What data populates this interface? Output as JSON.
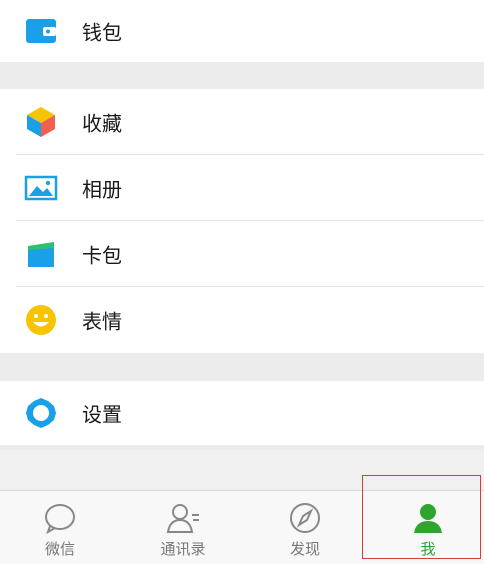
{
  "menu": {
    "wallet_label": "钱包",
    "favorites_label": "收藏",
    "album_label": "相册",
    "cards_label": "卡包",
    "stickers_label": "表情",
    "settings_label": "设置"
  },
  "tabbar": {
    "tabs": [
      {
        "label": "微信",
        "icon": "chat-bubble-icon"
      },
      {
        "label": "通讯录",
        "icon": "contacts-icon"
      },
      {
        "label": "发现",
        "icon": "compass-icon"
      },
      {
        "label": "我",
        "icon": "person-icon",
        "active": true
      }
    ]
  },
  "colors": {
    "active_green": "#2fa42f",
    "icon_blue": "#1aa0e8",
    "sticker_yellow": "#f6c400",
    "background_gray": "#ececec"
  }
}
